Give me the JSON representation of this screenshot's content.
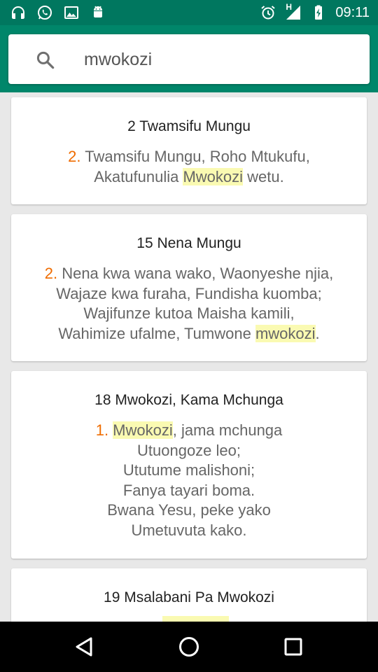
{
  "status_bar": {
    "time": "09:11",
    "left_icons": [
      "headphones-icon",
      "whatsapp-icon",
      "image-icon",
      "android-icon"
    ],
    "right_icons": [
      "alarm-icon",
      "signal-icon",
      "battery-charging-icon"
    ],
    "network_label": "H"
  },
  "search": {
    "query": "mwokozi",
    "icon": "search-icon"
  },
  "results": [
    {
      "title": "2 Twamsifu Mungu",
      "verse_number": "2.",
      "lines": [
        [
          {
            "t": "Twamsifu Mungu, Roho Mtukufu,",
            "hl": false
          }
        ],
        [
          {
            "t": "Akatufunulia ",
            "hl": false
          },
          {
            "t": "Mwokozi",
            "hl": true
          },
          {
            "t": " wetu.",
            "hl": false
          }
        ]
      ]
    },
    {
      "title": "15 Nena Mungu",
      "verse_number": "2.",
      "lines": [
        [
          {
            "t": "Nena kwa wana wako, Waonyeshe njia,",
            "hl": false
          }
        ],
        [
          {
            "t": "Wajaze kwa furaha, Fundisha kuomba;",
            "hl": false
          }
        ],
        [
          {
            "t": "Wajifunze kutoa Maisha kamili,",
            "hl": false
          }
        ],
        [
          {
            "t": "Wahimize ufalme, Tumwone ",
            "hl": false
          },
          {
            "t": "mwokozi",
            "hl": true
          },
          {
            "t": ".",
            "hl": false
          }
        ]
      ]
    },
    {
      "title": "18 Mwokozi, Kama Mchunga",
      "verse_number": "1.",
      "lines": [
        [
          {
            "t": "Mwokozi",
            "hl": true
          },
          {
            "t": ", jama mchunga",
            "hl": false
          }
        ],
        [
          {
            "t": "Utuongoze leo;",
            "hl": false
          }
        ],
        [
          {
            "t": "Ututume malishoni;",
            "hl": false
          }
        ],
        [
          {
            "t": "Fanya tayari boma.",
            "hl": false
          }
        ],
        [
          {
            "t": "Bwana Yesu, peke yako",
            "hl": false
          }
        ],
        [
          {
            "t": "Umetuvuta kako.",
            "hl": false
          }
        ]
      ]
    },
    {
      "title": "19 Msalabani Pa Mwokozi",
      "verse_number": "",
      "lines": []
    }
  ],
  "nav_bar": {
    "buttons": [
      "back-icon",
      "home-icon",
      "recents-icon"
    ]
  },
  "colors": {
    "status_bar": "#00775f",
    "app_bar": "#00866a",
    "accent": "#ef6c00",
    "highlight": "#fafab2"
  }
}
